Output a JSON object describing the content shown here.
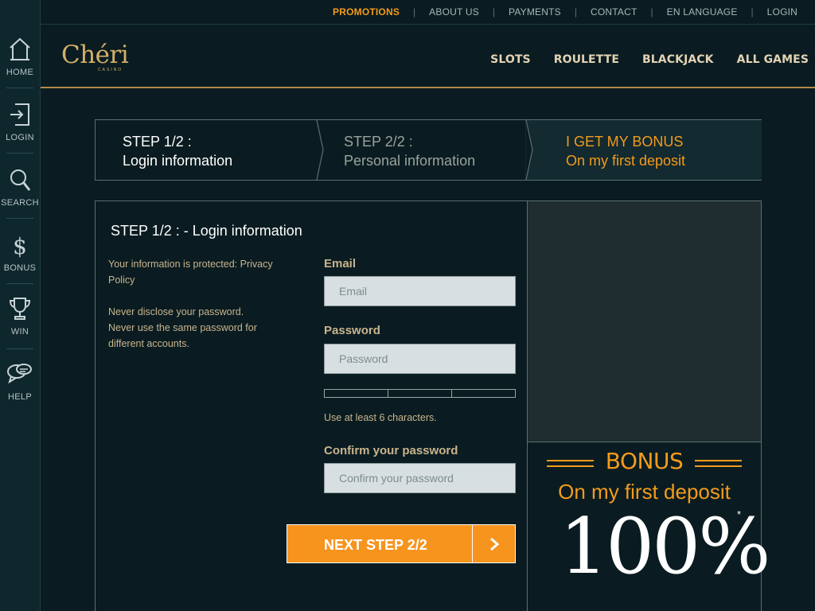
{
  "sidebar": {
    "items": [
      {
        "label": "HOME",
        "icon": "home-icon"
      },
      {
        "label": "LOGIN",
        "icon": "login-icon"
      },
      {
        "label": "SEARCH",
        "icon": "search-icon"
      },
      {
        "label": "BONUS",
        "icon": "dollar-icon"
      },
      {
        "label": "WIN",
        "icon": "trophy-icon"
      },
      {
        "label": "HELP",
        "icon": "chat-bubbles-icon"
      }
    ]
  },
  "topnav": {
    "links": [
      "PROMOTIONS",
      "ABOUT US",
      "PAYMENTS",
      "CONTACT",
      "EN LANGUAGE",
      "LOGIN"
    ],
    "separator": "|"
  },
  "header": {
    "logo_text": "Chéri",
    "logo_sub": "CASINO",
    "nav": [
      "SLOTS",
      "ROULETTE",
      "BLACKJACK",
      "ALL GAMES"
    ]
  },
  "steps": [
    {
      "line1": "STEP 1/2 :",
      "line2": "Login information"
    },
    {
      "line1": "STEP 2/2 :",
      "line2": "Personal information"
    },
    {
      "line1": "I GET MY BONUS",
      "line2": "On my first deposit"
    }
  ],
  "form": {
    "title": "STEP 1/2 : - Login information",
    "info": {
      "protected": "Your information is protected: Privacy Policy",
      "line1": "Never disclose your password.",
      "line2": "Never use the same password for different accounts."
    },
    "email": {
      "label": "Email",
      "placeholder": "Email",
      "value": ""
    },
    "password": {
      "label": "Password",
      "placeholder": "Password",
      "value": ""
    },
    "hint": "Use at least 6 characters.",
    "confirm": {
      "label": "Confirm your password",
      "placeholder": "Confirm your password",
      "value": ""
    },
    "next_button": "NEXT STEP 2/2"
  },
  "bonus": {
    "title": "BONUS",
    "subtitle": "On my first deposit",
    "amount": "100%",
    "footnote": "*"
  },
  "colors": {
    "accent": "#f39b1c",
    "gold": "#c9b48d",
    "background": "#0a1c21",
    "button": "#f7941d"
  }
}
